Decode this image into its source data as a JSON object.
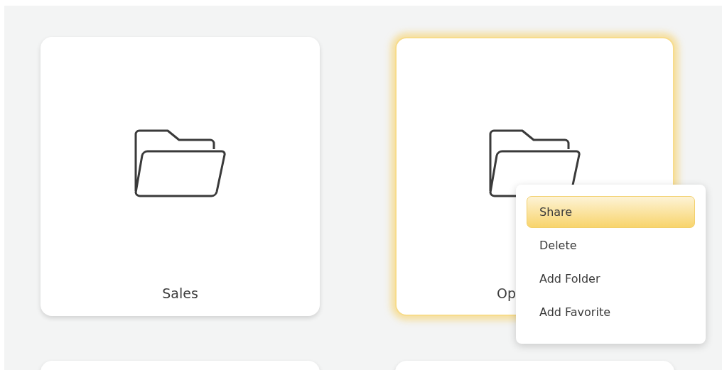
{
  "folders": [
    {
      "label": "Sales",
      "highlighted": false
    },
    {
      "label": "Op",
      "highlighted": true
    },
    {
      "highlighted": false
    },
    {
      "highlighted": false
    }
  ],
  "context_menu": {
    "items": [
      {
        "label": "Share",
        "selected": true
      },
      {
        "label": "Delete",
        "selected": false
      },
      {
        "label": "Add Folder",
        "selected": false
      },
      {
        "label": "Add Favorite",
        "selected": false
      }
    ]
  }
}
